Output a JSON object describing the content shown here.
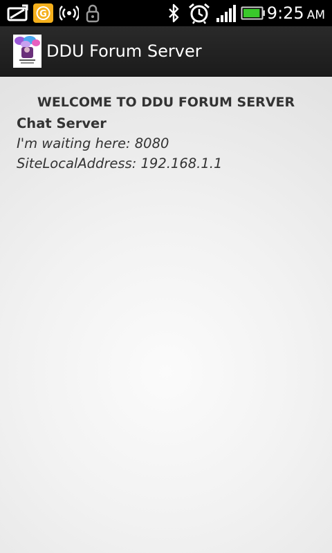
{
  "status_bar": {
    "icons": [
      "screen-mirror-icon",
      "app-notification-icon",
      "wifi-hotspot-icon",
      "lock-icon",
      "bluetooth-icon",
      "alarm-clock-icon",
      "signal-strength-icon",
      "battery-icon"
    ],
    "notification_badge_letter": "G",
    "time": "9:25",
    "ampm": "AM",
    "battery_level": 0.9
  },
  "action_bar": {
    "title": "DDU Forum Server",
    "icon": "app-logo-icon"
  },
  "content": {
    "welcome": "WELCOME TO DDU FORUM SERVER",
    "heading": "Chat Server",
    "waiting": "I'm waiting here: 8080",
    "address": "SiteLocalAddress: 192.168.1.1"
  },
  "colors": {
    "status_bar_bg": "#000000",
    "action_bar_bg": "#222222",
    "content_bg": "#efefef",
    "text": "#333333",
    "badge": "#f5b01c",
    "battery_fill": "#3ac92b"
  }
}
